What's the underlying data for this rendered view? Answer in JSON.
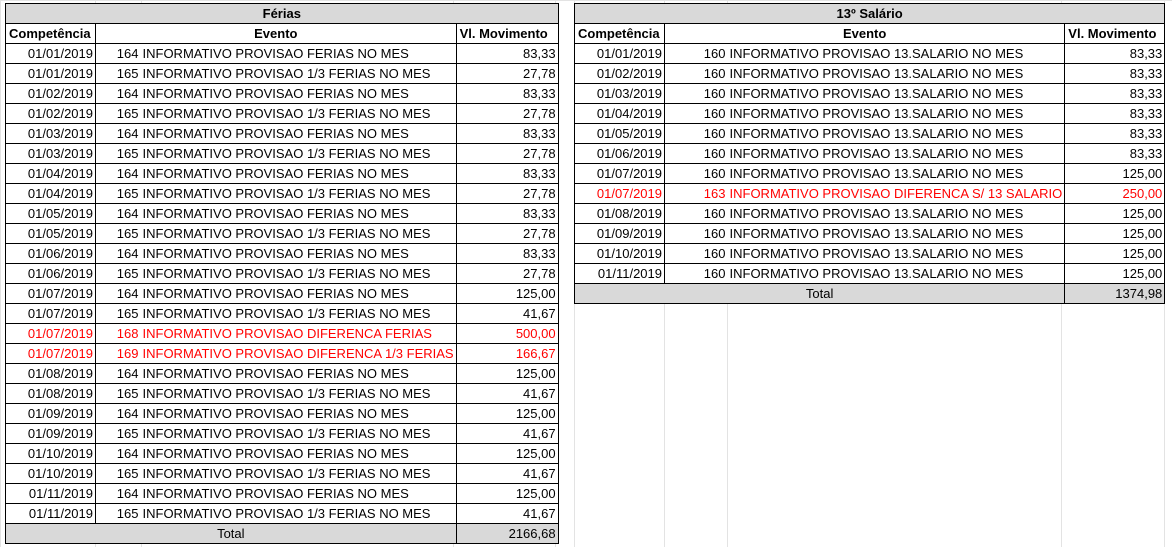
{
  "ferias": {
    "title": "Férias",
    "headers": {
      "competencia": "Competência",
      "evento": "Evento",
      "valor": "Vl. Movimento"
    },
    "rows": [
      {
        "date": "01/01/2019",
        "code": "164",
        "desc": "INFORMATIVO PROVISAO FERIAS NO MES",
        "value": "83,33",
        "highlight": false
      },
      {
        "date": "01/01/2019",
        "code": "165",
        "desc": "INFORMATIVO PROVISAO 1/3 FERIAS NO MES",
        "value": "27,78",
        "highlight": false
      },
      {
        "date": "01/02/2019",
        "code": "164",
        "desc": "INFORMATIVO PROVISAO FERIAS NO MES",
        "value": "83,33",
        "highlight": false
      },
      {
        "date": "01/02/2019",
        "code": "165",
        "desc": "INFORMATIVO PROVISAO 1/3 FERIAS NO MES",
        "value": "27,78",
        "highlight": false
      },
      {
        "date": "01/03/2019",
        "code": "164",
        "desc": "INFORMATIVO PROVISAO FERIAS NO MES",
        "value": "83,33",
        "highlight": false
      },
      {
        "date": "01/03/2019",
        "code": "165",
        "desc": "INFORMATIVO PROVISAO 1/3 FERIAS NO MES",
        "value": "27,78",
        "highlight": false
      },
      {
        "date": "01/04/2019",
        "code": "164",
        "desc": "INFORMATIVO PROVISAO FERIAS NO MES",
        "value": "83,33",
        "highlight": false
      },
      {
        "date": "01/04/2019",
        "code": "165",
        "desc": "INFORMATIVO PROVISAO 1/3 FERIAS NO MES",
        "value": "27,78",
        "highlight": false
      },
      {
        "date": "01/05/2019",
        "code": "164",
        "desc": "INFORMATIVO PROVISAO FERIAS NO MES",
        "value": "83,33",
        "highlight": false
      },
      {
        "date": "01/05/2019",
        "code": "165",
        "desc": "INFORMATIVO PROVISAO 1/3 FERIAS NO MES",
        "value": "27,78",
        "highlight": false
      },
      {
        "date": "01/06/2019",
        "code": "164",
        "desc": "INFORMATIVO PROVISAO FERIAS NO MES",
        "value": "83,33",
        "highlight": false
      },
      {
        "date": "01/06/2019",
        "code": "165",
        "desc": "INFORMATIVO PROVISAO 1/3 FERIAS NO MES",
        "value": "27,78",
        "highlight": false
      },
      {
        "date": "01/07/2019",
        "code": "164",
        "desc": "INFORMATIVO PROVISAO FERIAS NO MES",
        "value": "125,00",
        "highlight": false
      },
      {
        "date": "01/07/2019",
        "code": "165",
        "desc": "INFORMATIVO PROVISAO 1/3 FERIAS NO MES",
        "value": "41,67",
        "highlight": false
      },
      {
        "date": "01/07/2019",
        "code": "168",
        "desc": "INFORMATIVO PROVISAO DIFERENCA FERIAS",
        "value": "500,00",
        "highlight": true
      },
      {
        "date": "01/07/2019",
        "code": "169",
        "desc": "INFORMATIVO PROVISAO DIFERENCA 1/3 FERIAS",
        "value": "166,67",
        "highlight": true
      },
      {
        "date": "01/08/2019",
        "code": "164",
        "desc": "INFORMATIVO PROVISAO FERIAS NO MES",
        "value": "125,00",
        "highlight": false
      },
      {
        "date": "01/08/2019",
        "code": "165",
        "desc": "INFORMATIVO PROVISAO 1/3 FERIAS NO MES",
        "value": "41,67",
        "highlight": false
      },
      {
        "date": "01/09/2019",
        "code": "164",
        "desc": "INFORMATIVO PROVISAO FERIAS NO MES",
        "value": "125,00",
        "highlight": false
      },
      {
        "date": "01/09/2019",
        "code": "165",
        "desc": "INFORMATIVO PROVISAO 1/3 FERIAS NO MES",
        "value": "41,67",
        "highlight": false
      },
      {
        "date": "01/10/2019",
        "code": "164",
        "desc": "INFORMATIVO PROVISAO FERIAS NO MES",
        "value": "125,00",
        "highlight": false
      },
      {
        "date": "01/10/2019",
        "code": "165",
        "desc": "INFORMATIVO PROVISAO 1/3 FERIAS NO MES",
        "value": "41,67",
        "highlight": false
      },
      {
        "date": "01/11/2019",
        "code": "164",
        "desc": "INFORMATIVO PROVISAO FERIAS NO MES",
        "value": "125,00",
        "highlight": false
      },
      {
        "date": "01/11/2019",
        "code": "165",
        "desc": "INFORMATIVO PROVISAO 1/3 FERIAS NO MES",
        "value": "41,67",
        "highlight": false
      }
    ],
    "total_label": "Total",
    "total_value": "2166,68"
  },
  "decimo": {
    "title": "13º Salário",
    "headers": {
      "competencia": "Competência",
      "evento": "Evento",
      "valor": "Vl. Movimento"
    },
    "rows": [
      {
        "date": "01/01/2019",
        "code": "160",
        "desc": "INFORMATIVO PROVISAO 13.SALARIO NO MES",
        "value": "83,33",
        "highlight": false
      },
      {
        "date": "01/02/2019",
        "code": "160",
        "desc": "INFORMATIVO PROVISAO 13.SALARIO NO MES",
        "value": "83,33",
        "highlight": false
      },
      {
        "date": "01/03/2019",
        "code": "160",
        "desc": "INFORMATIVO PROVISAO 13.SALARIO NO MES",
        "value": "83,33",
        "highlight": false
      },
      {
        "date": "01/04/2019",
        "code": "160",
        "desc": "INFORMATIVO PROVISAO 13.SALARIO NO MES",
        "value": "83,33",
        "highlight": false
      },
      {
        "date": "01/05/2019",
        "code": "160",
        "desc": "INFORMATIVO PROVISAO 13.SALARIO NO MES",
        "value": "83,33",
        "highlight": false
      },
      {
        "date": "01/06/2019",
        "code": "160",
        "desc": "INFORMATIVO PROVISAO 13.SALARIO NO MES",
        "value": "83,33",
        "highlight": false
      },
      {
        "date": "01/07/2019",
        "code": "160",
        "desc": "INFORMATIVO PROVISAO 13.SALARIO NO MES",
        "value": "125,00",
        "highlight": false
      },
      {
        "date": "01/07/2019",
        "code": "163",
        "desc": "INFORMATIVO PROVISAO DIFERENCA S/ 13 SALARIO",
        "value": "250,00",
        "highlight": true
      },
      {
        "date": "01/08/2019",
        "code": "160",
        "desc": "INFORMATIVO PROVISAO 13.SALARIO NO MES",
        "value": "125,00",
        "highlight": false
      },
      {
        "date": "01/09/2019",
        "code": "160",
        "desc": "INFORMATIVO PROVISAO 13.SALARIO NO MES",
        "value": "125,00",
        "highlight": false
      },
      {
        "date": "01/10/2019",
        "code": "160",
        "desc": "INFORMATIVO PROVISAO 13.SALARIO NO MES",
        "value": "125,00",
        "highlight": false
      },
      {
        "date": "01/11/2019",
        "code": "160",
        "desc": "INFORMATIVO PROVISAO 13.SALARIO NO MES",
        "value": "125,00",
        "highlight": false
      }
    ],
    "total_label": "Total",
    "total_value": "1374,98"
  },
  "colors": {
    "highlight": "#ff0000",
    "header_fill": "#d9d9d9",
    "gridline": "#e3e3e3"
  }
}
